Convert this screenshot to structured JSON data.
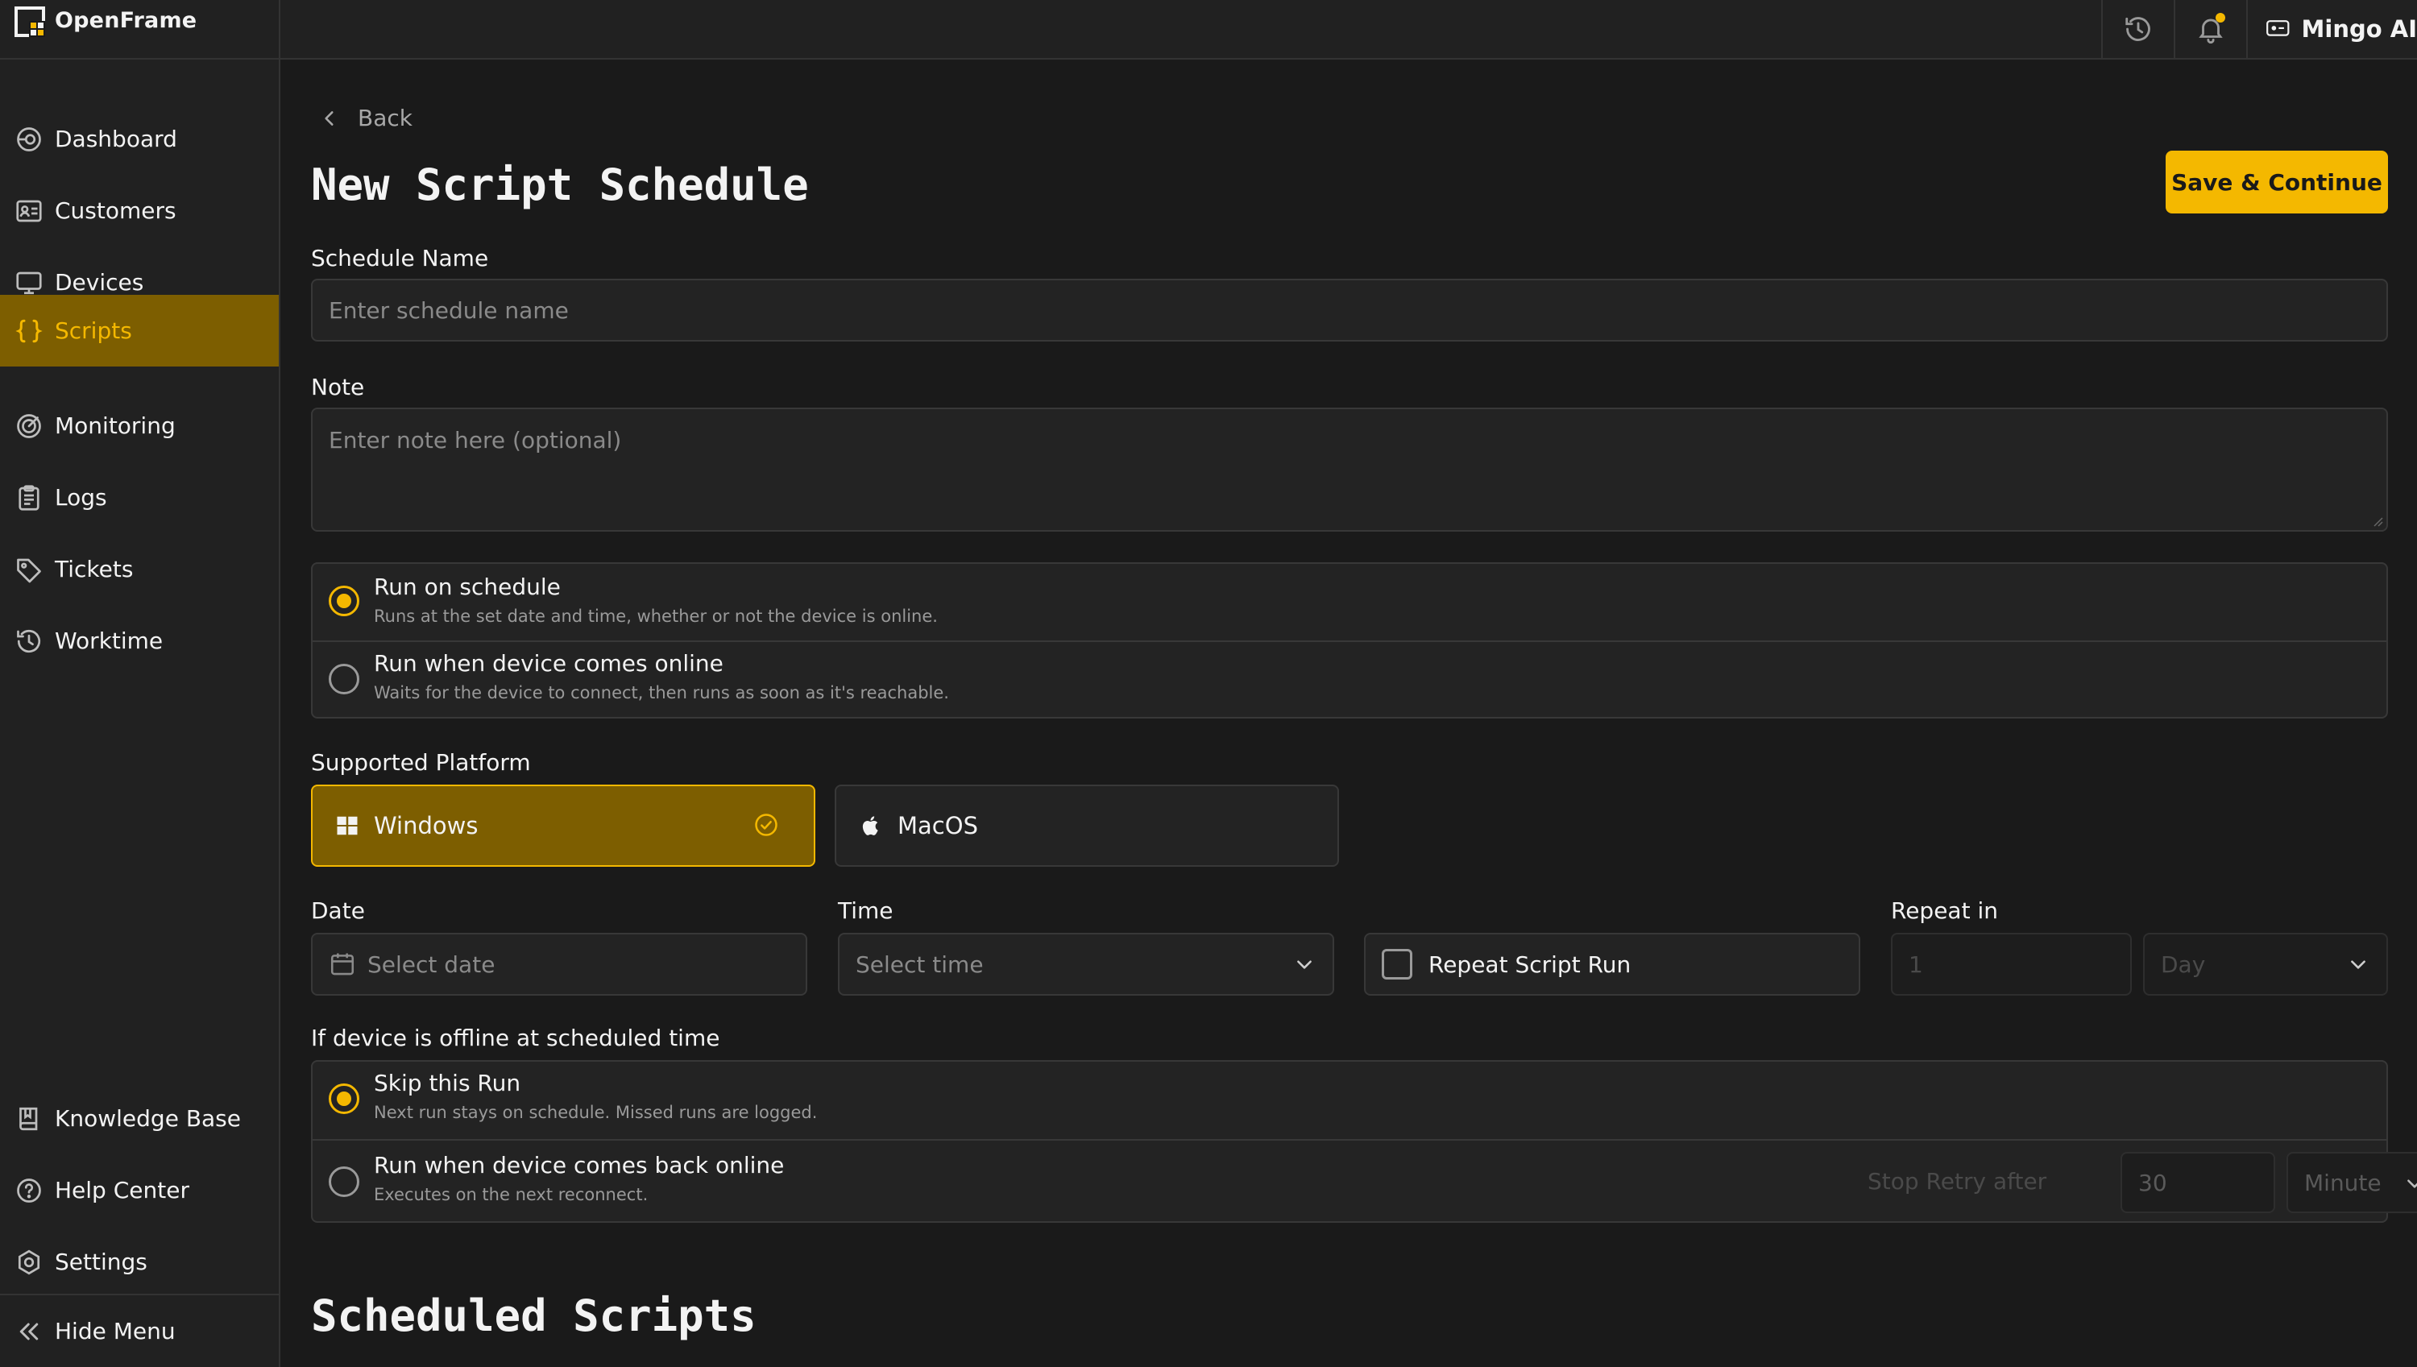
{
  "app": {
    "name": "OpenFrame"
  },
  "topbar": {
    "user_name": "Mingo AI",
    "history_icon": "history-icon",
    "bell_icon": "bell-icon"
  },
  "sidebar": {
    "items": [
      {
        "label": "Dashboard",
        "icon": "dashboard-icon"
      },
      {
        "label": "Customers",
        "icon": "customers-icon"
      },
      {
        "label": "Devices",
        "icon": "monitor-icon"
      },
      {
        "label": "Scripts",
        "icon": "braces-icon",
        "active": true
      },
      {
        "label": "Monitoring",
        "icon": "radar-icon"
      },
      {
        "label": "Logs",
        "icon": "clipboard-icon"
      },
      {
        "label": "Tickets",
        "icon": "tag-icon"
      },
      {
        "label": "Worktime",
        "icon": "history-icon"
      }
    ],
    "bottom_items": [
      {
        "label": "Knowledge Base",
        "icon": "book-icon"
      },
      {
        "label": "Help Center",
        "icon": "help-icon"
      },
      {
        "label": "Settings",
        "icon": "gear-icon"
      }
    ],
    "hide_menu": "Hide Menu"
  },
  "page": {
    "back": "Back",
    "title": "New Script Schedule",
    "save_button": "Save & Continue",
    "schedule_name": {
      "label": "Schedule Name",
      "placeholder": "Enter schedule name"
    },
    "note": {
      "label": "Note",
      "placeholder": "Enter note here (optional)"
    },
    "run_mode": [
      {
        "title": "Run on schedule",
        "desc": "Runs at the set date and time, whether or not the device is online.",
        "selected": true
      },
      {
        "title": "Run when device comes online",
        "desc": "Waits for the device to connect, then runs as soon as it's reachable.",
        "selected": false
      }
    ],
    "platform": {
      "label": "Supported Platform",
      "options": [
        {
          "label": "Windows",
          "selected": true
        },
        {
          "label": "MacOS",
          "selected": false
        }
      ]
    },
    "date": {
      "label": "Date",
      "placeholder": "Select date"
    },
    "time": {
      "label": "Time",
      "placeholder": "Select time"
    },
    "repeat": {
      "checkbox_label": "Repeat Script Run",
      "label": "Repeat in",
      "value": "1",
      "unit": "Day"
    },
    "offline": {
      "label": "If device is offline at scheduled time",
      "options": [
        {
          "title": "Skip this Run",
          "desc": "Next run stays on schedule. Missed runs are logged.",
          "selected": true
        },
        {
          "title": "Run when device comes back online",
          "desc": "Executes on the next reconnect.",
          "selected": false
        }
      ],
      "stop_retry_label": "Stop Retry after",
      "stop_retry_value": "30",
      "stop_retry_unit": "Minute"
    },
    "scheduled_title": "Scheduled Scripts"
  },
  "colors": {
    "accent": "#f4b800",
    "accent_dark": "#7d5e00",
    "background": "#1a1a1a",
    "panel": "#212121"
  }
}
